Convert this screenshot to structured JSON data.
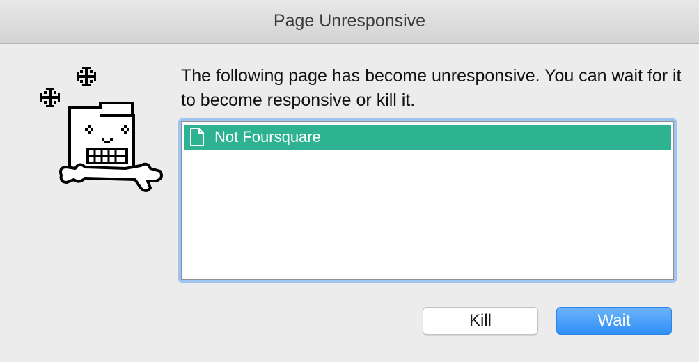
{
  "window": {
    "title": "Page Unresponsive"
  },
  "mascot": {
    "icon": "frozen-folder-mascot-icon"
  },
  "message": {
    "text": "The following page has become unresponsive. You can wait for it to become responsive or kill it."
  },
  "page_list": {
    "items": [
      {
        "label": "Not Foursquare",
        "icon": "document-icon",
        "selected": true
      }
    ],
    "selection_color": "#2db391"
  },
  "buttons": {
    "kill_label": "Kill",
    "wait_label": "Wait",
    "default_color": "#2f8ff7"
  }
}
